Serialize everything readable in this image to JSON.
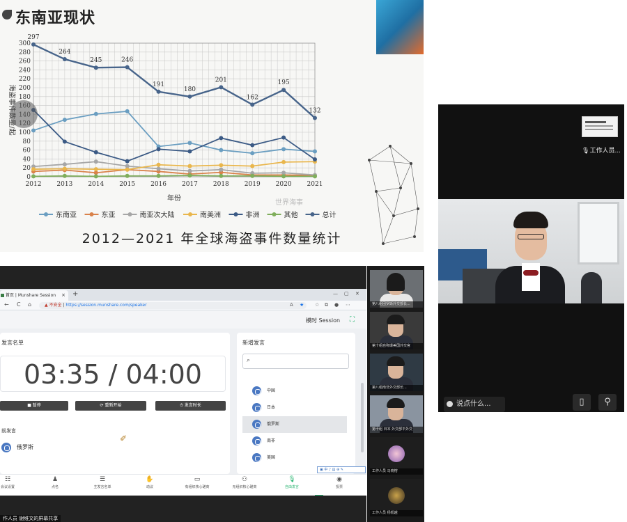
{
  "slide": {
    "title": "东南亚现状",
    "caption": "2012—2021 年全球海盗事件数量统计",
    "watermark": "世界海事"
  },
  "chart_data": {
    "type": "line",
    "title": "",
    "xlabel": "年份",
    "ylabel": "海盗事件数量/起",
    "ylim": [
      0,
      300
    ],
    "yticks": [
      0,
      20,
      40,
      60,
      80,
      100,
      120,
      140,
      160,
      180,
      200,
      220,
      240,
      260,
      280,
      300
    ],
    "x": [
      "2012",
      "2013",
      "2014",
      "2015",
      "2016",
      "2017",
      "2018",
      "2019",
      "2020",
      "2021"
    ],
    "series": [
      {
        "name": "东南亚",
        "color": "#6a9ec1",
        "values": [
          104,
          128,
          141,
          147,
          68,
          76,
          60,
          53,
          62,
          57
        ]
      },
      {
        "name": "东亚",
        "color": "#d9824a",
        "values": [
          12,
          15,
          9,
          16,
          12,
          6,
          10,
          4,
          4,
          3
        ]
      },
      {
        "name": "南亚次大陆",
        "color": "#a6a6a6",
        "values": [
          23,
          28,
          34,
          24,
          18,
          13,
          16,
          8,
          9,
          4
        ]
      },
      {
        "name": "南美洲",
        "color": "#e9b64c",
        "values": [
          17,
          18,
          17,
          16,
          27,
          24,
          26,
          24,
          33,
          34
        ]
      },
      {
        "name": "非洲",
        "color": "#3b5a85",
        "values": [
          150,
          79,
          55,
          35,
          62,
          57,
          87,
          71,
          88,
          39
        ]
      },
      {
        "name": "其他",
        "color": "#7fae5b",
        "values": [
          1,
          2,
          1,
          2,
          2,
          3,
          2,
          2,
          1,
          1
        ]
      },
      {
        "name": "总计",
        "color": "#47648a",
        "values": [
          297,
          264,
          245,
          246,
          191,
          180,
          201,
          162,
          195,
          132
        ]
      }
    ],
    "data_labels_series": "总计",
    "grid": true,
    "legend": "bottom"
  },
  "presenter": {
    "self_name": "工作人员...",
    "chat_placeholder": "说点什么...",
    "btn_device": "▯",
    "btn_pin": "⚲"
  },
  "browser": {
    "tab_title": "首页 | Munshare Session",
    "tab_close": "×",
    "new_tab": "+",
    "win_min": "—",
    "win_max": "▢",
    "win_close": "✕",
    "nav_back": "←",
    "nav_reload": "C",
    "nav_home": "⌂",
    "insecure": "▲ 不安全",
    "url_sep": " | ",
    "url": "https://session.munshare.com/speaker"
  },
  "app": {
    "session_label": "模时 Session",
    "speaker_list_title": "发言名单",
    "timer_text": "03:35 / 04:00",
    "controls": [
      {
        "label": "■ 暂停"
      },
      {
        "label": "⟳ 重新开始"
      },
      {
        "label": "⏱ 发言时长"
      }
    ],
    "current_speaker_label": "前发言",
    "current_speaker": "俄罗斯",
    "new_speech_title": "新增发言",
    "search_placeholder": "",
    "countries": [
      {
        "name": "中国",
        "selected": false
      },
      {
        "name": "日本",
        "selected": false
      },
      {
        "name": "俄罗斯",
        "selected": true
      },
      {
        "name": "南非",
        "selected": false
      },
      {
        "name": "美国",
        "selected": false
      }
    ],
    "float_toolbar": "▣ 中 ♪ ▤ ⊕ ✎",
    "nav": [
      {
        "icon": "☷",
        "label": "会议设置",
        "active": false
      },
      {
        "icon": "♟",
        "label": "点名",
        "active": false
      },
      {
        "icon": "☰",
        "label": "主发言名单",
        "active": false
      },
      {
        "icon": "✋",
        "label": "动议",
        "active": false
      },
      {
        "icon": "▭",
        "label": "有组织核心磋商",
        "active": false
      },
      {
        "icon": "⚇",
        "label": "无组织核心磋商",
        "active": false
      },
      {
        "icon": "🎙",
        "label": "自由发言",
        "active": true
      },
      {
        "icon": "◉",
        "label": "投票",
        "active": false
      }
    ]
  },
  "share_caption": "作人员 谢维文的屏幕共享",
  "participants": [
    {
      "name": "第八组团罗斯外交部长...",
      "kind": "female"
    },
    {
      "name": "第十组自称爆美国外交官",
      "kind": "male"
    },
    {
      "name": "第八组南非外交部长...",
      "kind": "male2"
    },
    {
      "name": "第十组 日本 外交部平外交",
      "kind": "male3"
    },
    {
      "name": "工作人员 马晓榕",
      "kind": "avatar1"
    },
    {
      "name": "工作人员 杨凯越",
      "kind": "avatar2"
    }
  ]
}
